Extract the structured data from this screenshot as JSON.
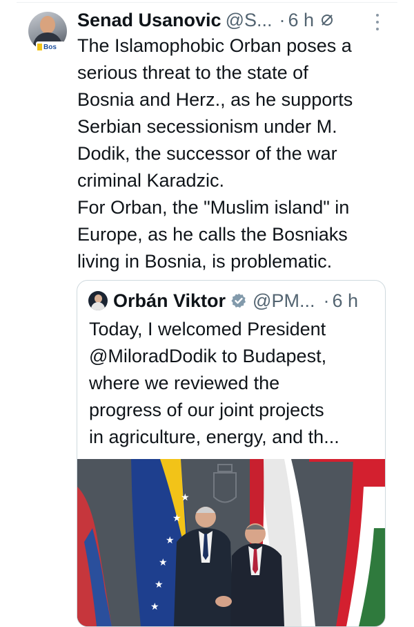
{
  "post": {
    "author_name": "Senad Usanovic",
    "author_handle": "@S...",
    "time": "6 h",
    "avatar_badge": "Bos",
    "text": "The Islamophobic Orban poses a\nserious threat to the state of\nBosnia and Herz., as he supports\nSerbian secessionism under M.\nDodik, the successor of the war\ncriminal Karadzic.\nFor Orban, the \"Muslim island\" in\nEurope, as he calls the Bosniaks\nliving in Bosnia, is problematic."
  },
  "quote": {
    "author_name": "Orbán Viktor",
    "author_handle": "@PM...",
    "time": "6 h",
    "text": "Today, I welcomed President\n@MiloradDodik to Budapest,\nwhere we reviewed the\nprogress of our joint projects\nin agriculture, energy, and th..."
  },
  "colors": {
    "text": "#0f1419",
    "muted": "#536471",
    "border": "#cfd9de",
    "verified": "#829aab"
  },
  "icons": {
    "grok": "grok-icon",
    "more": "more-icon",
    "verified": "verified-badge-icon"
  }
}
